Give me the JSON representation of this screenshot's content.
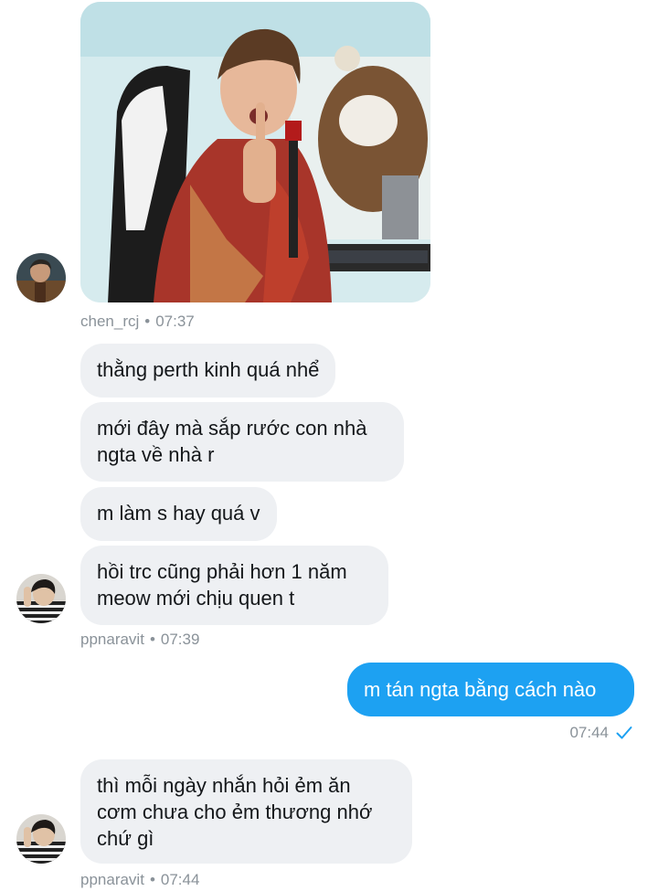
{
  "messages": [
    {
      "id": "m1",
      "text": "thằng perth kinh quá nhể"
    },
    {
      "id": "m2",
      "text": "mới đây mà sắp rước con nhà ngta về nhà r"
    },
    {
      "id": "m3",
      "text": "m làm s hay quá v"
    },
    {
      "id": "m4",
      "text": "hồi trc cũng phải hơn 1 năm meow mới chịu quen t"
    },
    {
      "id": "m5",
      "text": "m tán ngta bằng cách nào"
    },
    {
      "id": "m6",
      "text": "thì mỗi ngày nhắn hỏi ẻm ăn cơm chưa cho ẻm thương nhớ chứ gì"
    }
  ],
  "meta": {
    "group1": {
      "user": "chen_rcj",
      "time": "07:37"
    },
    "group2": {
      "user": "ppnaravit",
      "time": "07:39"
    },
    "sent": {
      "time": "07:44"
    },
    "group3": {
      "user": "ppnaravit",
      "time": "07:44"
    },
    "separator": "•"
  },
  "colors": {
    "incoming_bubble": "#eef0f3",
    "outgoing_bubble": "#1da1f2",
    "meta_text": "#8a9299",
    "read_check": "#1da1f2"
  },
  "icons": {
    "read_receipt": "checkmark-icon"
  }
}
